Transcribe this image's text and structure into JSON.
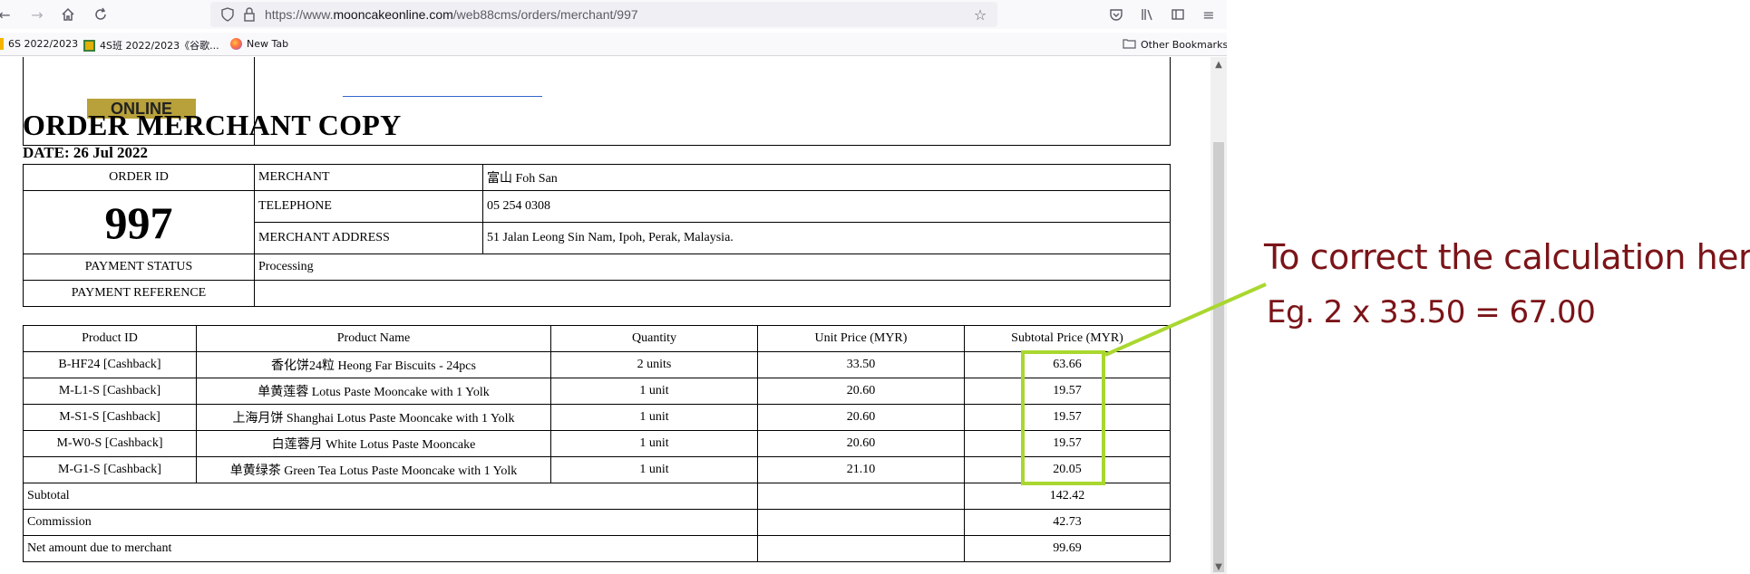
{
  "browser": {
    "url_prefix": "https://www.",
    "url_host": "mooncakeonline.com",
    "url_path": "/web88cms/orders/merchant/997",
    "bookmarks": [
      {
        "label": "6S 2022/2023"
      },
      {
        "label": "4S班 2022/2023《谷歌..."
      },
      {
        "label": "New Tab"
      }
    ],
    "other_bookmarks": "Other Bookmarks"
  },
  "page": {
    "logo_text": "ONLINE",
    "title": "ORDER MERCHANT COPY",
    "date": "DATE: 26 Jul 2022",
    "order": {
      "order_id_label": "ORDER ID",
      "order_id": "997",
      "merchant_label": "MERCHANT",
      "merchant": "富山 Foh San",
      "telephone_label": "TELEPHONE",
      "telephone": "05 254 0308",
      "address_label": "MERCHANT ADDRESS",
      "address": "51 Jalan Leong Sin Nam, Ipoh, Perak, Malaysia.",
      "payment_status_label": "PAYMENT STATUS",
      "payment_status": "Processing",
      "payment_reference_label": "PAYMENT REFERENCE",
      "payment_reference": ""
    },
    "products": {
      "headers": [
        "Product ID",
        "Product Name",
        "Quantity",
        "Unit Price (MYR)",
        "Subtotal Price (MYR)"
      ],
      "rows": [
        {
          "id": "B-HF24 [Cashback]",
          "name": "香化饼24粒 Heong Far Biscuits - 24pcs",
          "qty": "2 units",
          "unit": "33.50",
          "subtotal": "63.66"
        },
        {
          "id": "M-L1-S [Cashback]",
          "name": "单黄莲蓉 Lotus Paste Mooncake with 1 Yolk",
          "qty": "1 unit",
          "unit": "20.60",
          "subtotal": "19.57"
        },
        {
          "id": "M-S1-S [Cashback]",
          "name": "上海月饼 Shanghai Lotus Paste Mooncake with 1 Yolk",
          "qty": "1 unit",
          "unit": "20.60",
          "subtotal": "19.57"
        },
        {
          "id": "M-W0-S [Cashback]",
          "name": "白莲蓉月 White Lotus Paste Mooncake",
          "qty": "1 unit",
          "unit": "20.60",
          "subtotal": "19.57"
        },
        {
          "id": "M-G1-S [Cashback]",
          "name": "单黄绿茶 Green Tea Lotus Paste Mooncake with 1 Yolk",
          "qty": "1 unit",
          "unit": "21.10",
          "subtotal": "20.05"
        }
      ],
      "subtotal_label": "Subtotal",
      "subtotal": "142.42",
      "commission_label": "Commission",
      "commission": "42.73",
      "net_label": "Net amount due to merchant",
      "net": "99.69"
    }
  },
  "annotation": {
    "line1": "To correct the calculation here.",
    "line2": "Eg. 2 x 33.50 = 67.00",
    "highlight_color": "#a9d72f",
    "text_color": "#7b1418"
  }
}
